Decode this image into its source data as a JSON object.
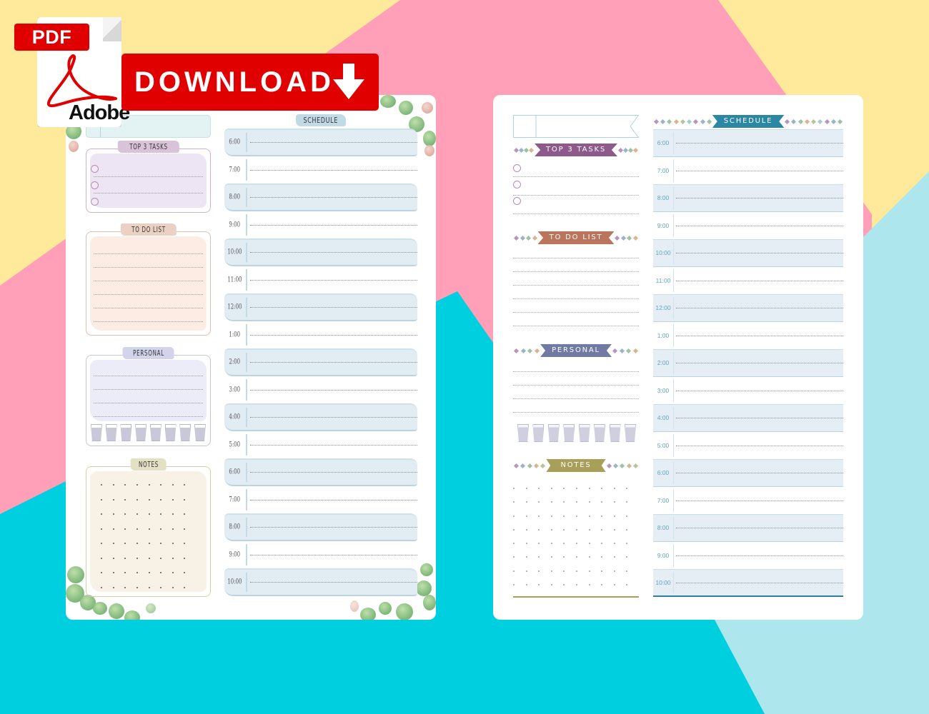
{
  "background": {
    "colors": {
      "yellow": "#ffe99a",
      "pink": "#ff9fb8",
      "cyan": "#00cfe0",
      "light_blue": "#aee6ee"
    }
  },
  "badge": {
    "pdf_label": "PDF",
    "adobe_label": "Adobe",
    "download_label": "DOWNLOAD",
    "icon": "download-arrow-icon",
    "brand_color": "#e00000"
  },
  "left_page": {
    "style": "watercolor",
    "top3_label": "TOP 3 TASKS",
    "todo_label": "TO DO LIST",
    "personal_label": "PERSONAL",
    "notes_label": "NOTES",
    "schedule_label": "SCHEDULE",
    "tasks_count": 3,
    "todo_lines": 6,
    "personal_lines": 4,
    "water_glasses": 8,
    "times": [
      "6:00",
      "7:00",
      "8:00",
      "9:00",
      "10:00",
      "11:00",
      "12:00",
      "1:00",
      "2:00",
      "3:00",
      "4:00",
      "5:00",
      "6:00",
      "7:00",
      "8:00",
      "9:00",
      "10:00"
    ]
  },
  "right_page": {
    "style": "clean",
    "top3_label": "TOP 3 TASKS",
    "todo_label": "TO DO LIST",
    "personal_label": "PERSONAL",
    "notes_label": "NOTES",
    "schedule_label": "SCHEDULE",
    "tasks_count": 3,
    "todo_lines": 6,
    "personal_lines": 4,
    "water_glasses": 8,
    "ribbon_colors": {
      "top3": "#8e5a8c",
      "todo": "#bb755c",
      "personal": "#717aa3",
      "notes": "#a8a058",
      "schedule": "#2b87a3"
    },
    "times": [
      "6:00",
      "7:00",
      "8:00",
      "9:00",
      "10:00",
      "11:00",
      "12:00",
      "1:00",
      "2:00",
      "3:00",
      "4:00",
      "5:00",
      "6:00",
      "7:00",
      "8:00",
      "9:00",
      "10:00"
    ]
  }
}
